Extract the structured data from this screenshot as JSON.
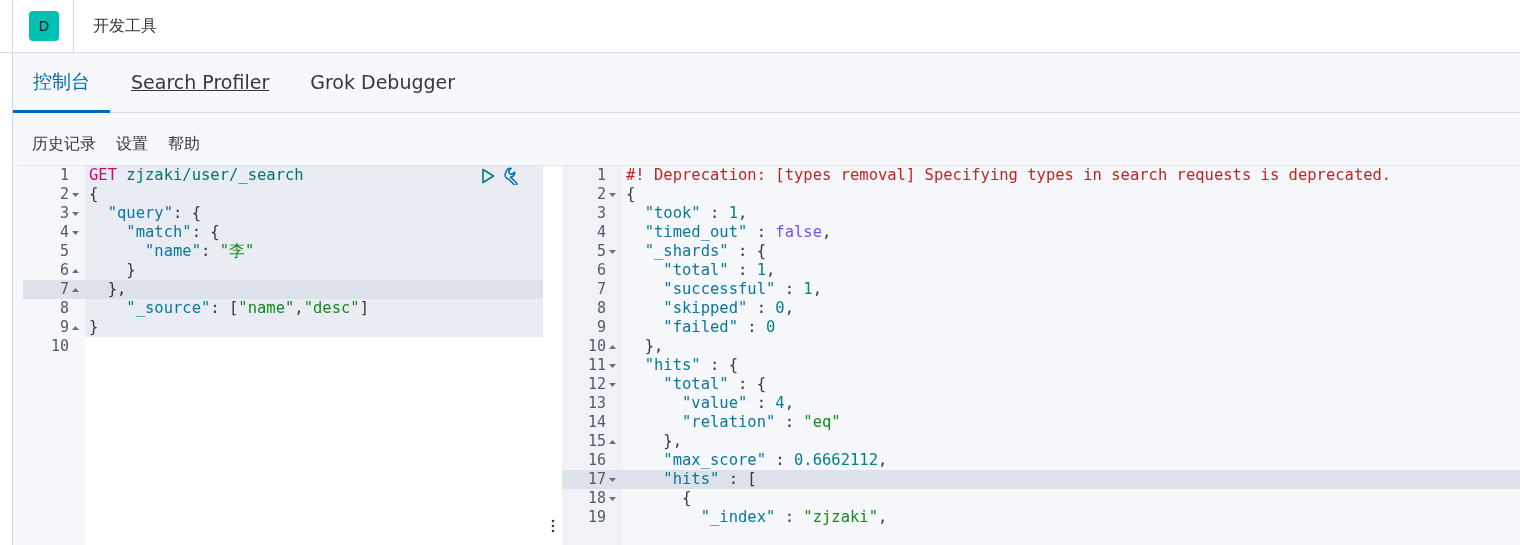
{
  "header": {
    "logo": "D",
    "title": "开发工具"
  },
  "tabs": [
    {
      "label": "控制台",
      "selected": true,
      "underlined": false
    },
    {
      "label": "Search Profiler",
      "selected": false,
      "underlined": true
    },
    {
      "label": "Grok Debugger",
      "selected": false,
      "underlined": false
    }
  ],
  "menu": [
    "历史记录",
    "设置",
    "帮助"
  ],
  "request_editor": {
    "lines": [
      {
        "number": "1",
        "fold_start": false,
        "fold_end": false,
        "highlighted": true,
        "active": false,
        "tokens": [
          {
            "kind": "method",
            "text": "GET"
          },
          {
            "kind": "url",
            "text": " zjzaki/user/_search"
          }
        ]
      },
      {
        "number": "2",
        "fold_start": true,
        "fold_end": false,
        "highlighted": true,
        "active": false,
        "tokens": [
          {
            "kind": "punct",
            "text": "{"
          }
        ]
      },
      {
        "number": "3",
        "fold_start": true,
        "fold_end": false,
        "highlighted": true,
        "active": false,
        "tokens": [
          {
            "kind": "key",
            "text": "  \"query\""
          },
          {
            "kind": "punct",
            "text": ": {"
          }
        ]
      },
      {
        "number": "4",
        "fold_start": true,
        "fold_end": false,
        "highlighted": true,
        "active": false,
        "tokens": [
          {
            "kind": "key",
            "text": "    \"match\""
          },
          {
            "kind": "punct",
            "text": ": {"
          }
        ]
      },
      {
        "number": "5",
        "fold_start": false,
        "fold_end": false,
        "highlighted": true,
        "active": false,
        "tokens": [
          {
            "kind": "key",
            "text": "      \"name\""
          },
          {
            "kind": "punct",
            "text": ": "
          },
          {
            "kind": "string",
            "text": "\"李\""
          }
        ]
      },
      {
        "number": "6",
        "fold_start": false,
        "fold_end": true,
        "highlighted": true,
        "active": false,
        "tokens": [
          {
            "kind": "punct",
            "text": "    }"
          }
        ]
      },
      {
        "number": "7",
        "fold_start": false,
        "fold_end": true,
        "highlighted": true,
        "active": true,
        "tokens": [
          {
            "kind": "punct",
            "text": "  },"
          }
        ]
      },
      {
        "number": "8",
        "fold_start": false,
        "fold_end": false,
        "highlighted": true,
        "active": false,
        "tokens": [
          {
            "kind": "key",
            "text": "    \"_source\""
          },
          {
            "kind": "punct",
            "text": ": ["
          },
          {
            "kind": "string",
            "text": "\"name\""
          },
          {
            "kind": "punct",
            "text": ","
          },
          {
            "kind": "string",
            "text": "\"desc\""
          },
          {
            "kind": "punct",
            "text": "]"
          }
        ]
      },
      {
        "number": "9",
        "fold_start": false,
        "fold_end": true,
        "highlighted": true,
        "active": false,
        "tokens": [
          {
            "kind": "punct",
            "text": "}"
          }
        ]
      },
      {
        "number": "10",
        "fold_start": false,
        "fold_end": false,
        "highlighted": false,
        "active": false
      }
    ]
  },
  "response_editor": {
    "lines": [
      {
        "number": "1",
        "fold_start": false,
        "fold_end": false,
        "active": false,
        "tokens": [
          {
            "kind": "warning",
            "text": "#! Deprecation: [types removal] Specifying types in search requests is deprecated."
          }
        ]
      },
      {
        "number": "2",
        "fold_start": true,
        "fold_end": false,
        "active": false,
        "tokens": [
          {
            "kind": "punct",
            "text": "{"
          }
        ]
      },
      {
        "number": "3",
        "fold_start": false,
        "fold_end": false,
        "active": false,
        "tokens": [
          {
            "kind": "key",
            "text": "  \"took\""
          },
          {
            "kind": "punct",
            "text": " : "
          },
          {
            "kind": "number",
            "text": "1"
          },
          {
            "kind": "punct",
            "text": ","
          }
        ]
      },
      {
        "number": "4",
        "fold_start": false,
        "fold_end": false,
        "active": false,
        "tokens": [
          {
            "kind": "key",
            "text": "  \"timed_out\""
          },
          {
            "kind": "punct",
            "text": " : "
          },
          {
            "kind": "bool",
            "text": "false"
          },
          {
            "kind": "punct",
            "text": ","
          }
        ]
      },
      {
        "number": "5",
        "fold_start": true,
        "fold_end": false,
        "active": false,
        "tokens": [
          {
            "kind": "key",
            "text": "  \"_shards\""
          },
          {
            "kind": "punct",
            "text": " : {"
          }
        ]
      },
      {
        "number": "6",
        "fold_start": false,
        "fold_end": false,
        "active": false,
        "tokens": [
          {
            "kind": "key",
            "text": "    \"total\""
          },
          {
            "kind": "punct",
            "text": " : "
          },
          {
            "kind": "number",
            "text": "1"
          },
          {
            "kind": "punct",
            "text": ","
          }
        ]
      },
      {
        "number": "7",
        "fold_start": false,
        "fold_end": false,
        "active": false,
        "tokens": [
          {
            "kind": "key",
            "text": "    \"successful\""
          },
          {
            "kind": "punct",
            "text": " : "
          },
          {
            "kind": "number",
            "text": "1"
          },
          {
            "kind": "punct",
            "text": ","
          }
        ]
      },
      {
        "number": "8",
        "fold_start": false,
        "fold_end": false,
        "active": false,
        "tokens": [
          {
            "kind": "key",
            "text": "    \"skipped\""
          },
          {
            "kind": "punct",
            "text": " : "
          },
          {
            "kind": "number",
            "text": "0"
          },
          {
            "kind": "punct",
            "text": ","
          }
        ]
      },
      {
        "number": "9",
        "fold_start": false,
        "fold_end": false,
        "active": false,
        "tokens": [
          {
            "kind": "key",
            "text": "    \"failed\""
          },
          {
            "kind": "punct",
            "text": " : "
          },
          {
            "kind": "number",
            "text": "0"
          }
        ]
      },
      {
        "number": "10",
        "fold_start": false,
        "fold_end": true,
        "active": false,
        "tokens": [
          {
            "kind": "punct",
            "text": "  },"
          }
        ]
      },
      {
        "number": "11",
        "fold_start": true,
        "fold_end": false,
        "active": false,
        "tokens": [
          {
            "kind": "key",
            "text": "  \"hits\""
          },
          {
            "kind": "punct",
            "text": " : {"
          }
        ]
      },
      {
        "number": "12",
        "fold_start": true,
        "fold_end": false,
        "active": false,
        "tokens": [
          {
            "kind": "key",
            "text": "    \"total\""
          },
          {
            "kind": "punct",
            "text": " : {"
          }
        ]
      },
      {
        "number": "13",
        "fold_start": false,
        "fold_end": false,
        "active": false,
        "tokens": [
          {
            "kind": "key",
            "text": "      \"value\""
          },
          {
            "kind": "punct",
            "text": " : "
          },
          {
            "kind": "number",
            "text": "4"
          },
          {
            "kind": "punct",
            "text": ","
          }
        ]
      },
      {
        "number": "14",
        "fold_start": false,
        "fold_end": false,
        "active": false,
        "tokens": [
          {
            "kind": "key",
            "text": "      \"relation\""
          },
          {
            "kind": "punct",
            "text": " : "
          },
          {
            "kind": "string",
            "text": "\"eq\""
          }
        ]
      },
      {
        "number": "15",
        "fold_start": false,
        "fold_end": true,
        "active": false,
        "tokens": [
          {
            "kind": "punct",
            "text": "    },"
          }
        ]
      },
      {
        "number": "16",
        "fold_start": false,
        "fold_end": false,
        "active": false,
        "tokens": [
          {
            "kind": "key",
            "text": "    \"max_score\""
          },
          {
            "kind": "punct",
            "text": " : "
          },
          {
            "kind": "number",
            "text": "0.6662112"
          },
          {
            "kind": "punct",
            "text": ","
          }
        ]
      },
      {
        "number": "17",
        "fold_start": true,
        "fold_end": false,
        "active": true,
        "tokens": [
          {
            "kind": "key",
            "text": "    \"hits\""
          },
          {
            "kind": "punct",
            "text": " : ["
          }
        ]
      },
      {
        "number": "18",
        "fold_start": true,
        "fold_end": false,
        "active": false,
        "tokens": [
          {
            "kind": "punct",
            "text": "      {"
          }
        ]
      },
      {
        "number": "19",
        "fold_start": false,
        "fold_end": false,
        "active": false,
        "tokens": [
          {
            "kind": "key",
            "text": "        \"_index\""
          },
          {
            "kind": "punct",
            "text": " : "
          },
          {
            "kind": "string",
            "text": "\"zjzaki\""
          },
          {
            "kind": "punct",
            "text": ","
          }
        ]
      }
    ]
  }
}
